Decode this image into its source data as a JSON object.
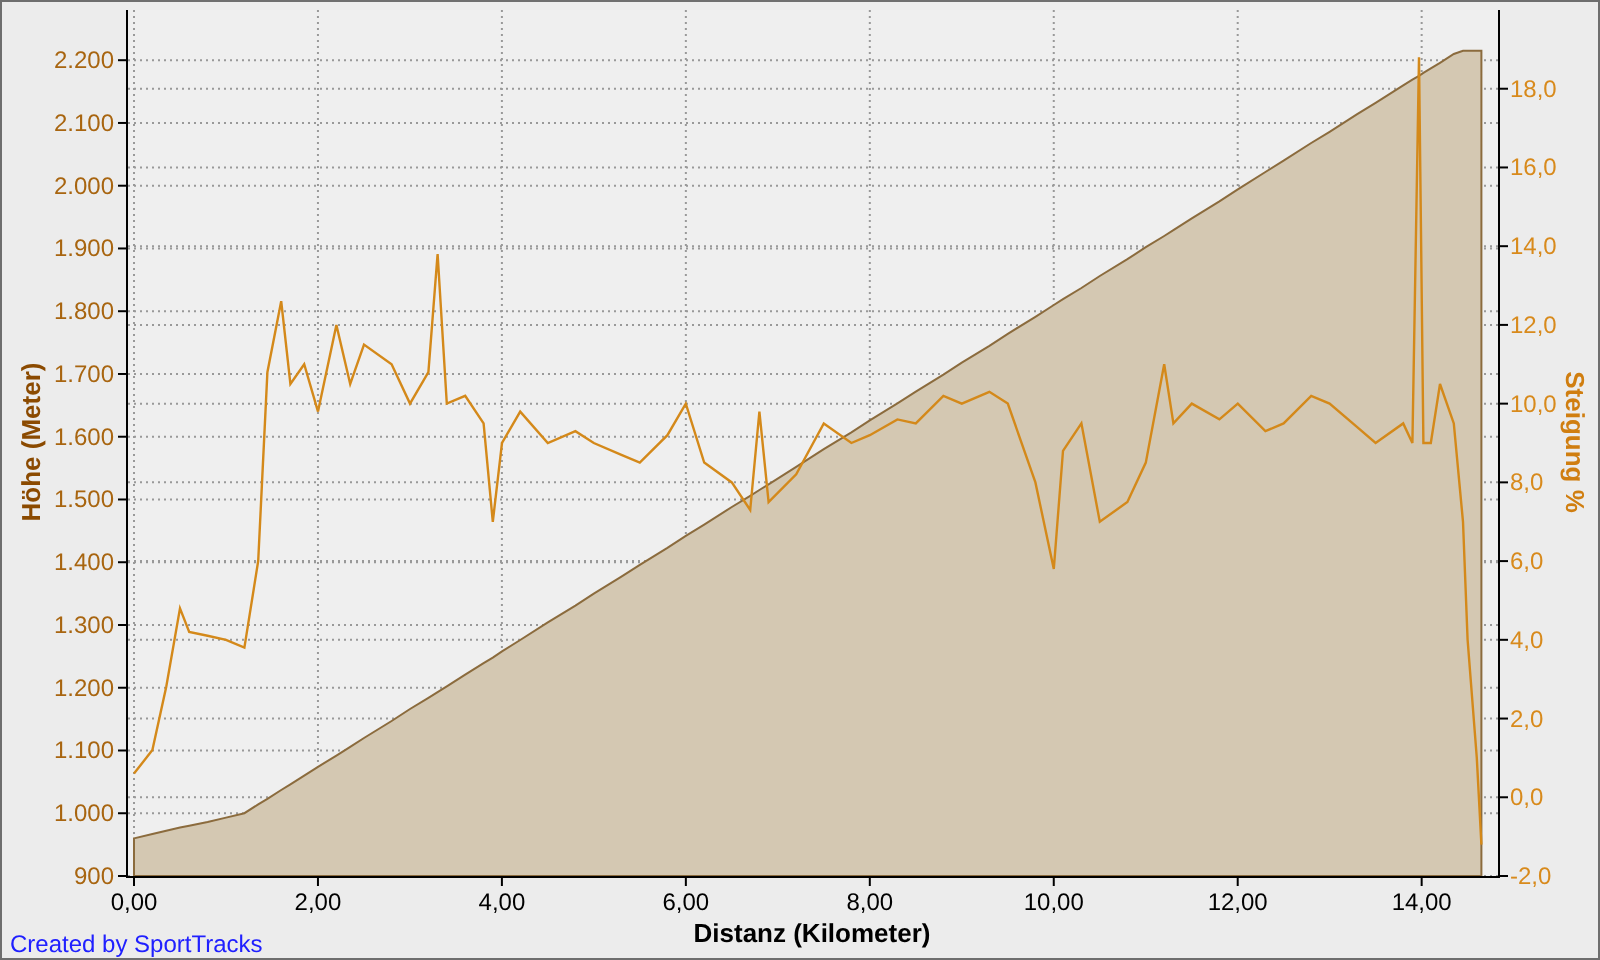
{
  "chart": {
    "chart_data": {
      "type": "area",
      "xlabel": "Distanz (Kilometer)",
      "ylabel": "Höhe (Meter)",
      "y2label": "Steigung %",
      "grid": true,
      "xlim": [
        0,
        14.83
      ],
      "ylim": [
        900,
        2280
      ],
      "y2lim": [
        -2,
        20
      ],
      "xticks": [
        {
          "value": 0,
          "label": "0,00"
        },
        {
          "value": 2,
          "label": "2,00"
        },
        {
          "value": 4,
          "label": "4,00"
        },
        {
          "value": 6,
          "label": "6,00"
        },
        {
          "value": 8,
          "label": "8,00"
        },
        {
          "value": 10,
          "label": "10,00"
        },
        {
          "value": 12,
          "label": "12,00"
        },
        {
          "value": 14,
          "label": "14,00"
        }
      ],
      "yticks": [
        {
          "value": 900,
          "label": "900"
        },
        {
          "value": 1000,
          "label": "1.000"
        },
        {
          "value": 1100,
          "label": "1.100"
        },
        {
          "value": 1200,
          "label": "1.200"
        },
        {
          "value": 1300,
          "label": "1.300"
        },
        {
          "value": 1400,
          "label": "1.400"
        },
        {
          "value": 1500,
          "label": "1.500"
        },
        {
          "value": 1600,
          "label": "1.600"
        },
        {
          "value": 1700,
          "label": "1.700"
        },
        {
          "value": 1800,
          "label": "1.800"
        },
        {
          "value": 1900,
          "label": "1.900"
        },
        {
          "value": 2000,
          "label": "2.000"
        },
        {
          "value": 2100,
          "label": "2.100"
        },
        {
          "value": 2200,
          "label": "2.200"
        }
      ],
      "y2ticks": [
        {
          "value": -2,
          "label": "-2,0"
        },
        {
          "value": 0,
          "label": "0,0"
        },
        {
          "value": 2,
          "label": "2,0"
        },
        {
          "value": 4,
          "label": "4,0"
        },
        {
          "value": 6,
          "label": "6,0"
        },
        {
          "value": 8,
          "label": "8,0"
        },
        {
          "value": 10,
          "label": "10,0"
        },
        {
          "value": 12,
          "label": "12,0"
        },
        {
          "value": 14,
          "label": "14,0"
        },
        {
          "value": 16,
          "label": "16,0"
        },
        {
          "value": 18,
          "label": "18,0"
        }
      ],
      "x": [
        0,
        0.2,
        0.35,
        0.5,
        0.6,
        0.8,
        1,
        1.2,
        1.35,
        1.45,
        1.6,
        1.7,
        1.85,
        2,
        2.2,
        2.35,
        2.5,
        2.8,
        3,
        3.2,
        3.3,
        3.4,
        3.6,
        3.8,
        3.9,
        4,
        4.2,
        4.5,
        4.8,
        5,
        5.3,
        5.5,
        5.8,
        6,
        6.2,
        6.5,
        6.7,
        6.8,
        6.9,
        7.2,
        7.5,
        7.8,
        8,
        8.3,
        8.5,
        8.8,
        9,
        9.3,
        9.5,
        9.8,
        10,
        10.1,
        10.3,
        10.5,
        10.8,
        11,
        11.2,
        11.3,
        11.5,
        11.8,
        12,
        12.3,
        12.5,
        12.8,
        13,
        13.3,
        13.5,
        13.8,
        13.9,
        13.97,
        14.02,
        14.1,
        14.2,
        14.35,
        14.45,
        14.5,
        14.6,
        14.65
      ],
      "series": [
        {
          "color": "#d4c8b2",
          "values": [
            960,
            967,
            972,
            977,
            980,
            986,
            993,
            1000,
            1014,
            1023,
            1037,
            1046,
            1060,
            1074,
            1092,
            1106,
            1120,
            1147,
            1166,
            1184,
            1193,
            1202,
            1221,
            1239,
            1248,
            1258,
            1276,
            1304,
            1331,
            1350,
            1377,
            1396,
            1423,
            1442,
            1460,
            1488,
            1506,
            1515,
            1524,
            1552,
            1580,
            1607,
            1626,
            1653,
            1672,
            1699,
            1718,
            1745,
            1764,
            1791,
            1810,
            1819,
            1837,
            1856,
            1883,
            1902,
            1920,
            1929,
            1948,
            1975,
            1994,
            2022,
            2040,
            2068,
            2086,
            2114,
            2132,
            2160,
            2169,
            2175,
            2180,
            2187,
            2196,
            2210,
            2215,
            2215,
            2215,
            2215
          ]
        },
        {
          "color": "#d4891a",
          "type": "line",
          "axis": "y2",
          "values": [
            0.6,
            1.2,
            2.8,
            4.8,
            4.2,
            4.1,
            4.0,
            3.8,
            6,
            10.8,
            12.6,
            10.5,
            11,
            9.8,
            12,
            10.5,
            11.5,
            11,
            10,
            10.8,
            13.8,
            10,
            10.2,
            9.5,
            7,
            9,
            9.8,
            9,
            9.3,
            9,
            8.7,
            8.5,
            9.2,
            10,
            8.5,
            8,
            7.3,
            9.8,
            7.5,
            8.2,
            9.5,
            9,
            9.2,
            9.6,
            9.5,
            10.2,
            10,
            10.3,
            10,
            8,
            5.8,
            8.8,
            9.5,
            7,
            7.5,
            8.5,
            11,
            9.5,
            10,
            9.6,
            10,
            9.3,
            9.5,
            10.2,
            10,
            9.4,
            9,
            9.5,
            9,
            18.8,
            9,
            9,
            10.5,
            9.5,
            7,
            4,
            1,
            -1.2
          ]
        }
      ]
    },
    "credit": "Created by SportTracks"
  }
}
